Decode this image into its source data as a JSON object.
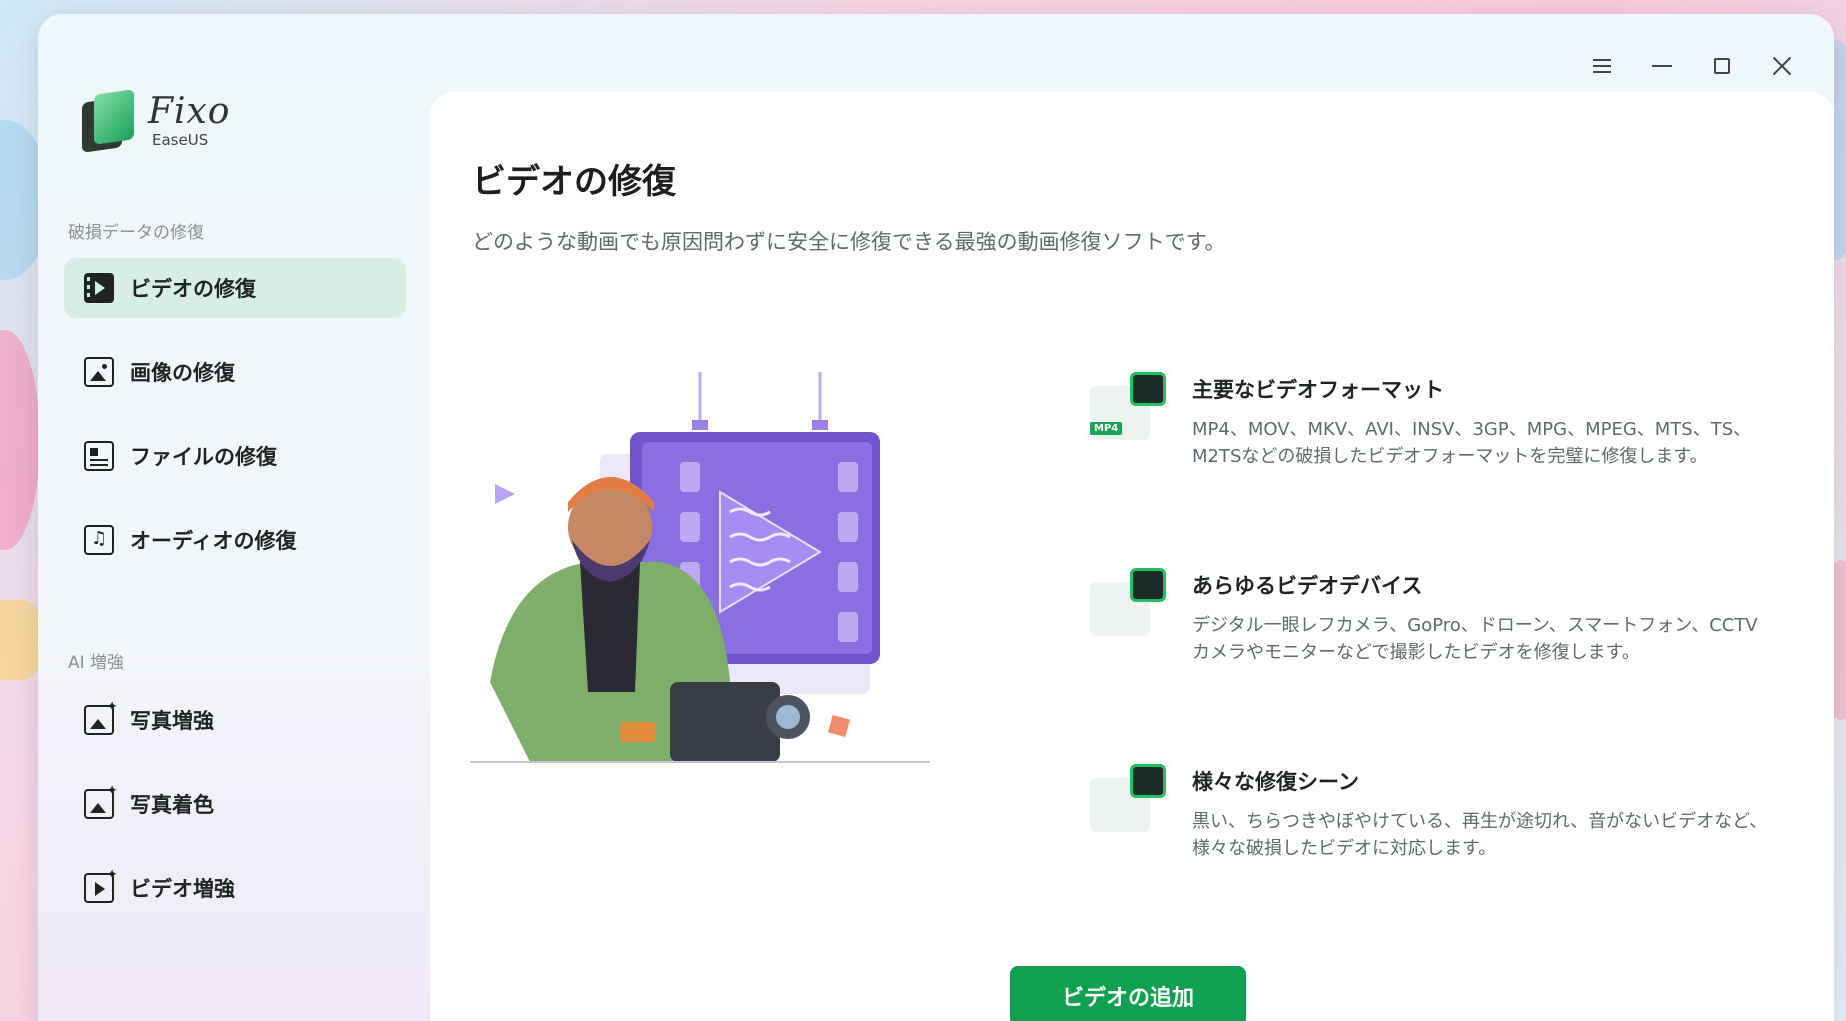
{
  "app": {
    "name": "Fixo",
    "vendor": "EaseUS"
  },
  "window_controls": {
    "menu": "menu-icon",
    "minimize": "minimize-icon",
    "maximize": "maximize-icon",
    "close": "close-icon"
  },
  "sidebar": {
    "section_repair": "破損データの修復",
    "section_ai": "AI 増強",
    "items": [
      {
        "label": "ビデオの修復",
        "icon": "video-icon",
        "active": true
      },
      {
        "label": "画像の修復",
        "icon": "image-icon",
        "active": false
      },
      {
        "label": "ファイルの修復",
        "icon": "file-icon",
        "active": false
      },
      {
        "label": "オーディオの修復",
        "icon": "audio-icon",
        "active": false
      },
      {
        "label": "写真増強",
        "icon": "photo-enhance-icon",
        "active": false
      },
      {
        "label": "写真着色",
        "icon": "photo-colorize-icon",
        "active": false
      },
      {
        "label": "ビデオ増強",
        "icon": "video-enhance-icon",
        "active": false
      }
    ]
  },
  "main": {
    "title": "ビデオの修復",
    "description": "どのような動画でも原因問わずに安全に修復できる最強の動画修復ソフトです。",
    "features": [
      {
        "title": "主要なビデオフォーマット",
        "desc": "MP4、MOV、MKV、AVI、INSV、3GP、MPG、MPEG、MTS、TS、M2TSなどの破損したビデオフォーマットを完璧に修復します。",
        "icon": "video-format-icon",
        "tag": "MP4"
      },
      {
        "title": "あらゆるビデオデバイス",
        "desc": "デジタル一眼レフカメラ、GoPro、ドローン、スマートフォン、CCTVカメラやモニターなどで撮影したビデオを修復します。",
        "icon": "video-device-icon"
      },
      {
        "title": "様々な修復シーン",
        "desc": "黒い、ちらつきやぼやけている、再生が途切れ、音がないビデオなど、様々な破損したビデオに対応します。",
        "icon": "repair-scene-icon"
      }
    ],
    "add_button": "ビデオの追加"
  },
  "colors": {
    "accent": "#10a052",
    "active_bg": "#d7eee4",
    "purple": "#7b5fd0"
  }
}
